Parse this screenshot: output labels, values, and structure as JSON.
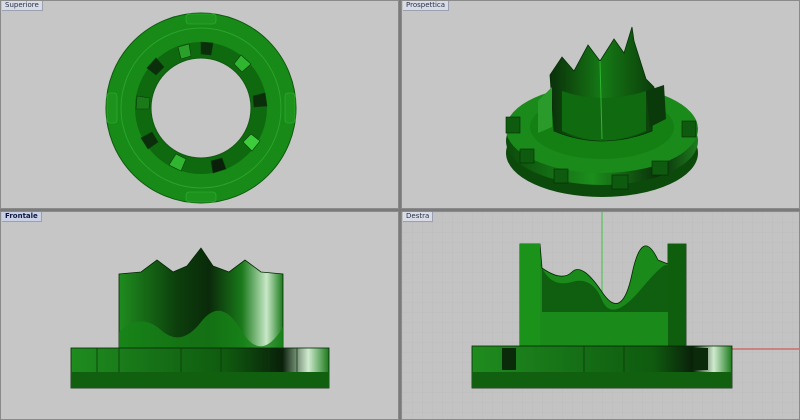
{
  "viewports": {
    "top_left": {
      "label": "Superiore"
    },
    "top_right": {
      "label": "Prospettica"
    },
    "bottom_left": {
      "label": "Frontale"
    },
    "bottom_right": {
      "label": "Destra"
    }
  },
  "colors": {
    "viewport_bg": "#c6c6c6",
    "model_green": "#1f8a1f",
    "model_dark": "#0b3d0b",
    "model_highlight": "#3dbf3d",
    "grid_line": "#b5b5b5",
    "axis_x": "#d04040",
    "axis_y": "#40c040"
  }
}
